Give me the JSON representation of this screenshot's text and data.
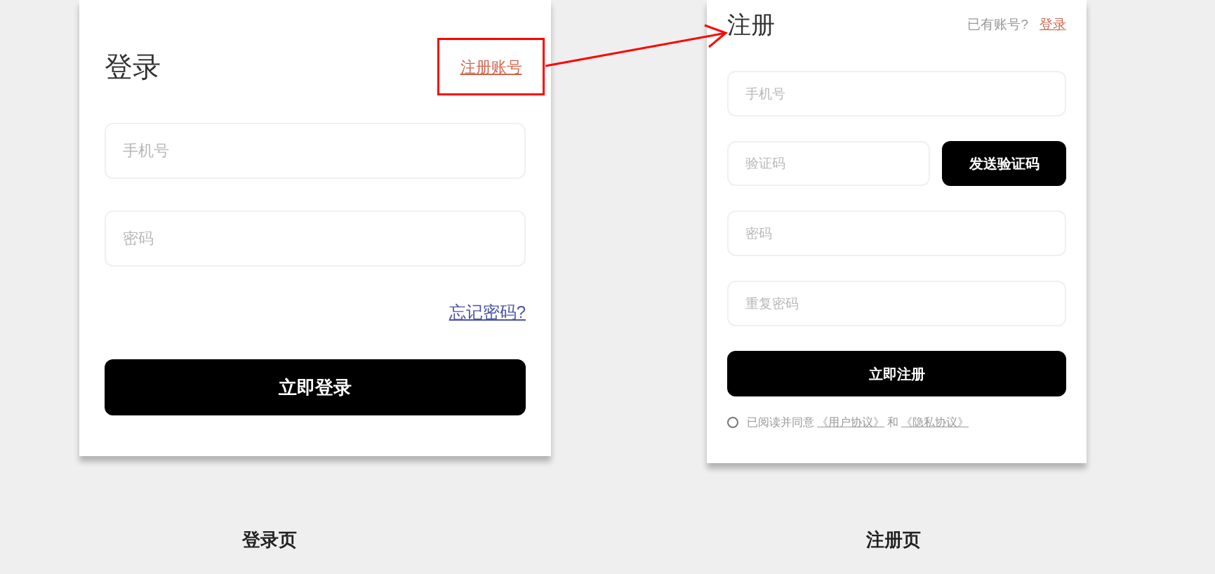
{
  "login": {
    "title": "登录",
    "register_link": "注册账号",
    "fields": [
      {
        "placeholder": "手机号"
      },
      {
        "placeholder": "密码"
      }
    ],
    "forgot_link": "忘记密码?",
    "submit": "立即登录",
    "caption": "登录页"
  },
  "register": {
    "title": "注册",
    "have_account": "已有账号?",
    "login_link": "登录",
    "fields": [
      {
        "kind": "text",
        "placeholder": "手机号"
      },
      {
        "kind": "code",
        "placeholder": "验证码",
        "button": "发送验证码"
      },
      {
        "kind": "text",
        "placeholder": "密码"
      },
      {
        "kind": "text",
        "placeholder": "重复密码"
      }
    ],
    "submit": "立即注册",
    "agreement": {
      "checked": false,
      "text": "已阅读并同意",
      "user_link": "《用户协议》",
      "and": "和",
      "privacy_link": "《隐私协议》"
    },
    "caption": "注册页"
  }
}
